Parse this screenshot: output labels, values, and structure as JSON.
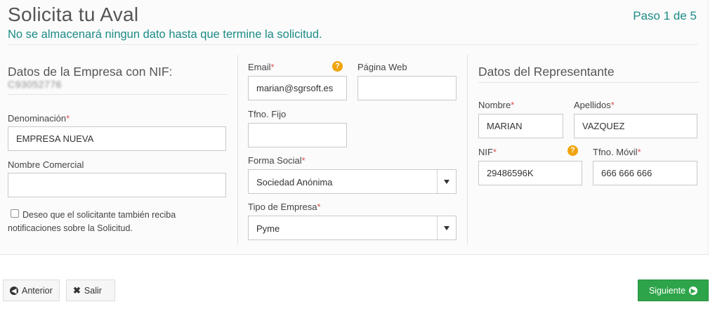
{
  "header": {
    "title": "Solicita tu Aval",
    "subtitle": "No se almacenará ningun dato hasta que termine la solicitud.",
    "step": "Paso 1 de 5"
  },
  "empresa": {
    "section_title": "Datos de la Empresa con NIF:",
    "nif_masked": "C93052776",
    "denominacion_label": "Denominación",
    "denominacion_value": "EMPRESA NUEVA",
    "nombre_comercial_label": "Nombre Comercial",
    "nombre_comercial_value": "",
    "notify_label": "Deseo que el solicitante también reciba notificaciones sobre la Solicitud.",
    "notify_checked": false
  },
  "contacto": {
    "email_label": "Email",
    "email_value": "marian@sgrsoft.es",
    "web_label": "Página Web",
    "web_value": "",
    "tfno_fijo_label": "Tfno. Fijo",
    "tfno_fijo_value": "",
    "forma_social_label": "Forma Social",
    "forma_social_value": "Sociedad Anónima",
    "tipo_empresa_label": "Tipo de Empresa",
    "tipo_empresa_value": "Pyme"
  },
  "representante": {
    "section_title": "Datos del Representante",
    "nombre_label": "Nombre",
    "nombre_value": "MARIAN",
    "apellidos_label": "Apellidos",
    "apellidos_value": "VAZQUEZ",
    "nif_label": "NIF",
    "nif_value": "29486596K",
    "movil_label": "Tfno. Móvil",
    "movil_value": "666 666 666"
  },
  "common": {
    "required_mark": "*",
    "help_glyph": "?"
  },
  "footer": {
    "back_label": "Anterior",
    "exit_label": "Salir",
    "next_label": "Siguiente"
  },
  "colors": {
    "accent": "#1c8b86",
    "required": "#d9534f",
    "help": "#f0a30a",
    "primary_button": "#2ea44a"
  },
  "icons": {
    "help": "question-circle-icon",
    "back": "arrow-circle-left-icon",
    "exit": "times-icon",
    "next": "arrow-circle-right-icon",
    "select": "caret-down-icon"
  }
}
